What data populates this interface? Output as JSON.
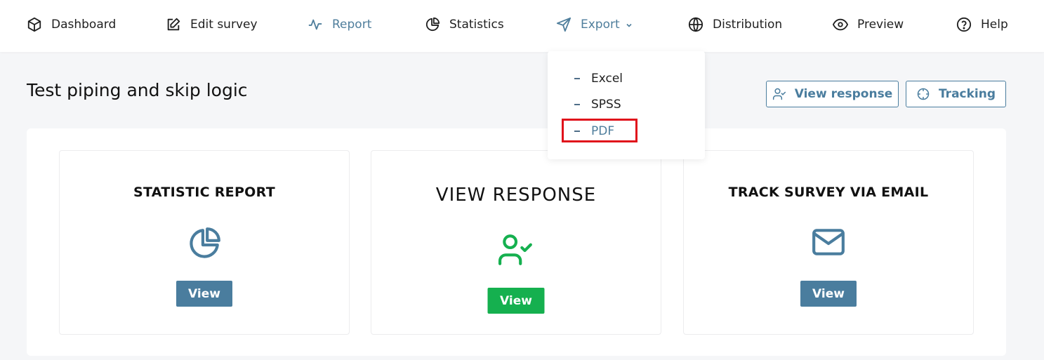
{
  "nav": {
    "dashboard": "Dashboard",
    "edit_survey": "Edit survey",
    "report": "Report",
    "statistics": "Statistics",
    "export": "Export",
    "distribution": "Distribution",
    "preview": "Preview",
    "help": "Help"
  },
  "export_menu": {
    "items": [
      "Excel",
      "SPSS",
      "PDF"
    ],
    "highlighted": "PDF"
  },
  "page": {
    "title": "Test piping and skip logic",
    "view_response_btn": "View response",
    "tracking_btn": "Tracking"
  },
  "cards": [
    {
      "title": "STATISTIC REPORT",
      "button": "View",
      "icon": "pie-chart-icon"
    },
    {
      "title": "VIEW RESPONSE",
      "button": "View",
      "icon": "user-check-icon"
    },
    {
      "title": "TRACK SURVEY VIA EMAIL",
      "button": "View",
      "icon": "mail-icon"
    }
  ],
  "colors": {
    "accent": "#4a7d9e",
    "green": "#15b04f",
    "highlight": "#e0121b"
  }
}
